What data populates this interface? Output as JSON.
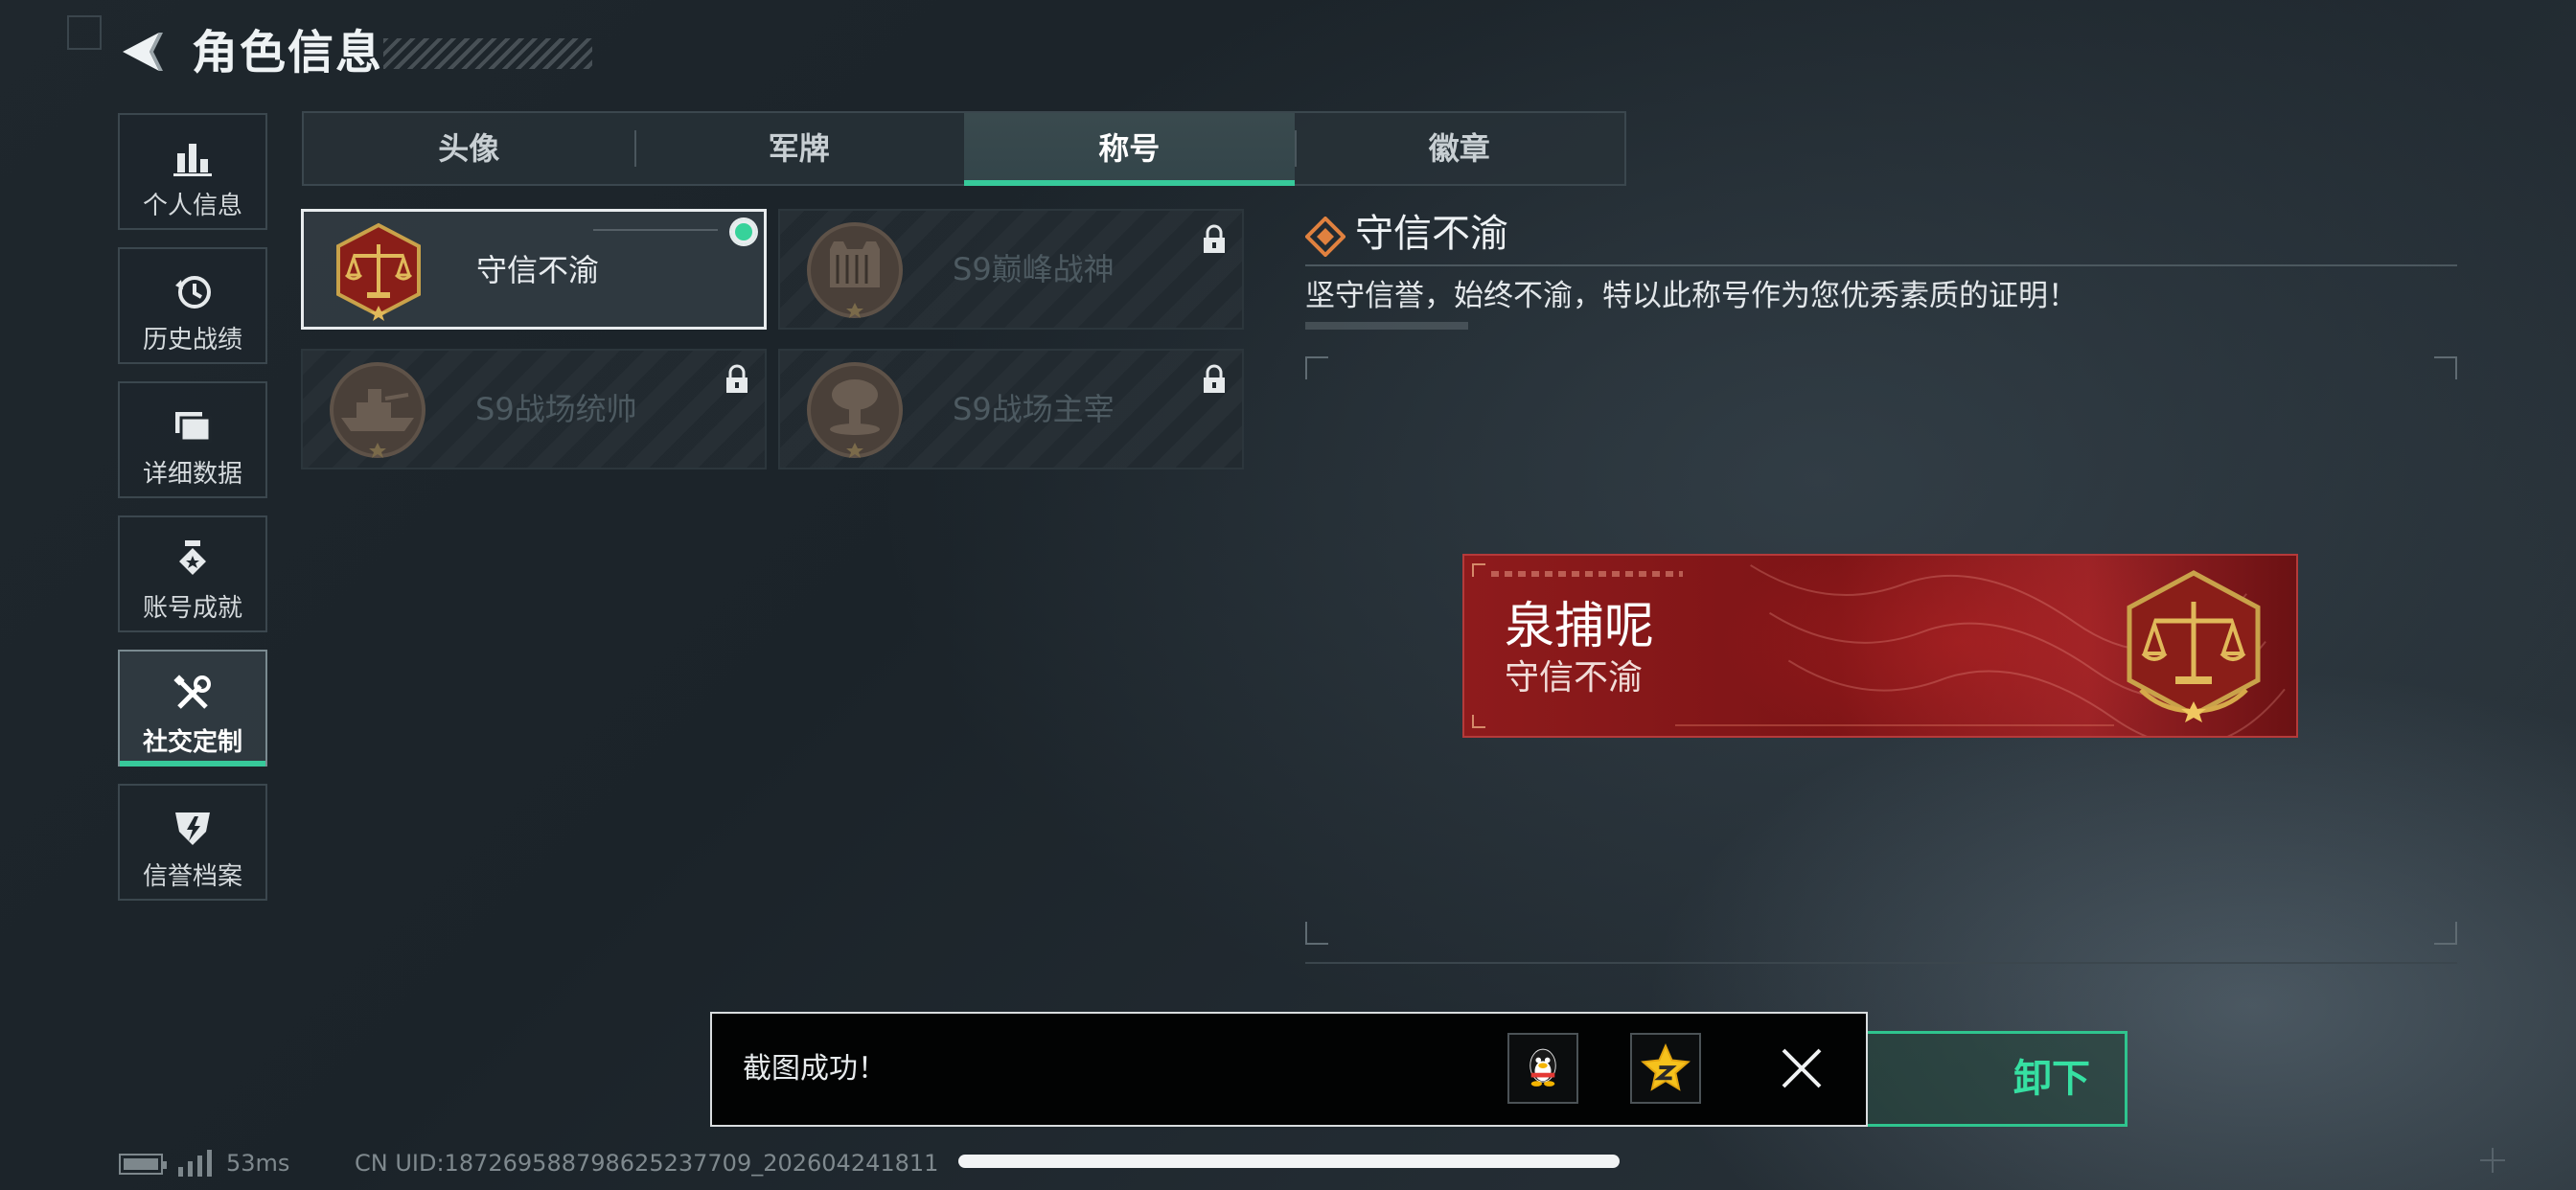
{
  "header": {
    "title": "角色信息"
  },
  "sidebar": {
    "items": [
      {
        "label": "个人信息",
        "icon": "bar-chart-icon"
      },
      {
        "label": "历史战绩",
        "icon": "history-icon"
      },
      {
        "label": "详细数据",
        "icon": "folder-icon"
      },
      {
        "label": "账号成就",
        "icon": "achievement-icon"
      },
      {
        "label": "社交定制",
        "icon": "tools-icon",
        "active": true
      },
      {
        "label": "信誉档案",
        "icon": "credit-shield-icon"
      }
    ]
  },
  "tabs": [
    {
      "label": "头像"
    },
    {
      "label": "军牌"
    },
    {
      "label": "称号",
      "active": true
    },
    {
      "label": "徽章"
    }
  ],
  "titles": [
    {
      "name": "守信不渝",
      "locked": false,
      "selected": true
    },
    {
      "name": "S9巅峰战神",
      "locked": true
    },
    {
      "name": "S9战场统帅",
      "locked": true
    },
    {
      "name": "S9战场主宰",
      "locked": true
    }
  ],
  "detail": {
    "title": "守信不渝",
    "description": "坚守信誉，始终不渝，特以此称号作为您优秀素质的证明！"
  },
  "nameplate": {
    "player_name": "泉捕呢",
    "title": "守信不渝"
  },
  "equip_button": {
    "label_visible": "卸下"
  },
  "toast": {
    "text": "截图成功！"
  },
  "status_bar": {
    "ping": "53ms",
    "uid": "CN UID:18726958879862523770​9_202604241811"
  },
  "colors": {
    "accent": "#37c99a",
    "nameplate_red": "#8e1b1c",
    "emblem_gold": "#c9a24a"
  }
}
